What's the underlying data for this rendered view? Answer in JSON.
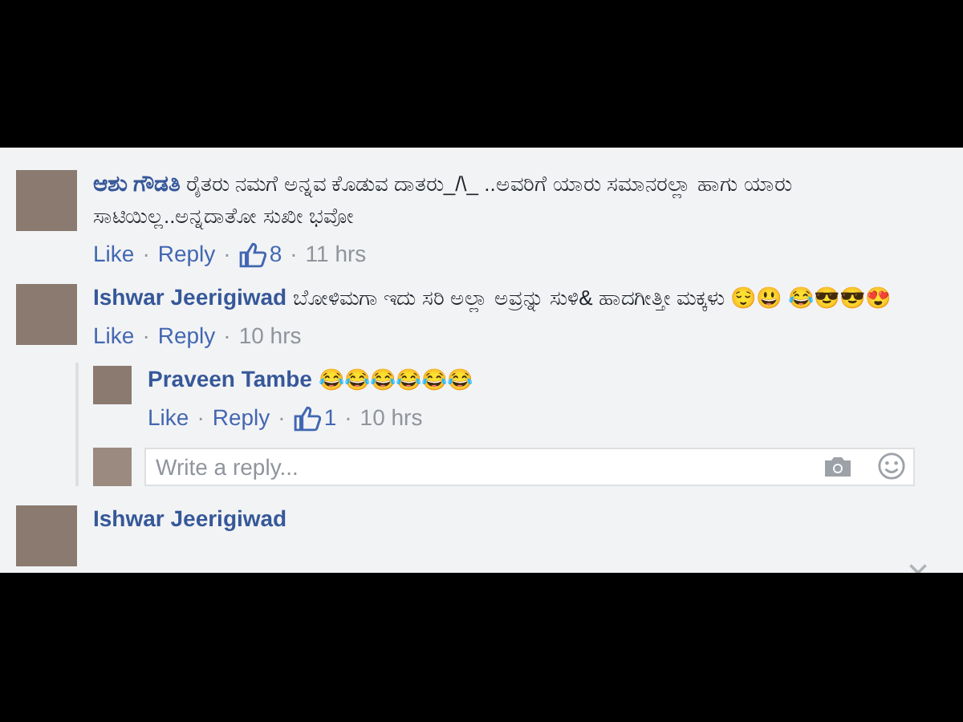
{
  "comments": [
    {
      "author": "ಆಶು ಗೌಡತಿ",
      "text": "ರೈತರು ನಮಗೆ ಅನ್ನವ ಕೊಡುವ ದಾತರು_/\\_ ..ಅವರಿಗೆ ಯಾರು ಸಮಾನರಲ್ಲಾ ಹಾಗು ಯಾರು ಸಾಟಿಯಿಲ್ಲ..ಅನ್ನದಾತೋ ಸುಖೀ ಭವೋ",
      "actions": [
        "Like",
        "Reply"
      ],
      "separators": [
        "·",
        "·",
        "·"
      ],
      "likes": "8",
      "time": "11 hrs"
    },
    {
      "author": "Ishwar Jeerigiwad",
      "text": "ಬೋಳಿಮಗಾ ಇದು ಸರಿ ಅಲ್ಲಾ ಅವ್ರನ್ನು ಸುಳಿ& ಹಾದಗೀತ್ತೀ ಮಕ್ಕಳು 😌😃 😂😎😎😍",
      "actions": [
        "Like",
        "Reply"
      ],
      "separators": [
        "·",
        "·"
      ],
      "time": "10 hrs",
      "replies": [
        {
          "author": "Praveen Tambe",
          "text": "😂😂😂😂😂😂",
          "actions": [
            "Like",
            "Reply"
          ],
          "separators": [
            "·",
            "·",
            "·"
          ],
          "likes": "1",
          "time": "10 hrs"
        }
      ],
      "reply_box": {
        "placeholder": "Write a reply..."
      }
    },
    {
      "author": "Ishwar Jeerigiwad"
    }
  ]
}
